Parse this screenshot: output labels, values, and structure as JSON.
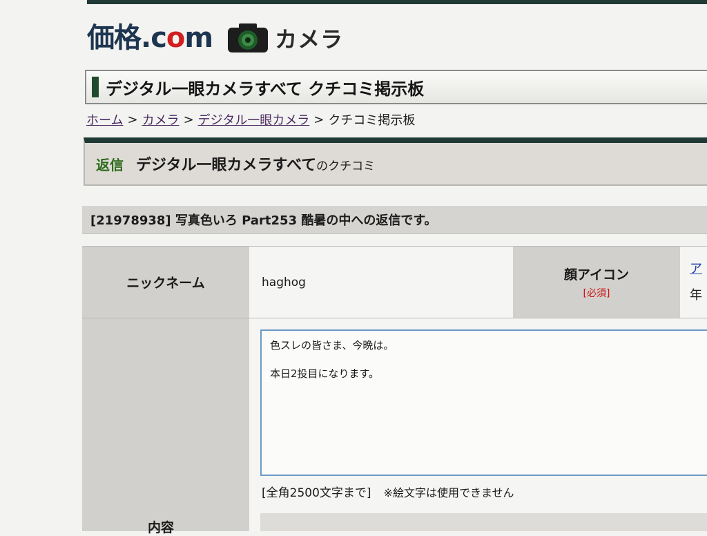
{
  "logo": {
    "brand": "価格",
    "dot_com": ".c",
    "o": "o",
    "m": "m",
    "section": "カメラ"
  },
  "title_box": {
    "title": "デジタル一眼カメラすべて クチコミ掲示板"
  },
  "breadcrumb": {
    "items": [
      "ホーム",
      "カメラ",
      "デジタル一眼カメラ"
    ],
    "separator": ">",
    "current": "クチコミ掲示板"
  },
  "reply_panel": {
    "label": "返信",
    "title": "デジタル一眼カメラすべて",
    "suffix": "のクチコミ"
  },
  "subject": {
    "text": "[21978938] 写真色いろ  Part253  酷暑の中への返信です。"
  },
  "form": {
    "nickname_label": "ニックネーム",
    "nickname_value": "haghog",
    "face_icon_label": "顔アイコン",
    "face_icon_required": "[必須]",
    "face_icon_link": "ア",
    "face_icon_age": "年",
    "content_label": "内容",
    "content_lines": [
      "色スレの皆さま、今晩は。",
      "本日2投目になります。"
    ],
    "char_limit": "[全角2500文字まで]",
    "emoji_note": "※絵文字は使用できません"
  },
  "colors": {
    "accent_dark": "#1f3a34",
    "reply_green": "#2f6b1c",
    "required_red": "#cc1111",
    "link_blue": "#1d3ea8"
  }
}
